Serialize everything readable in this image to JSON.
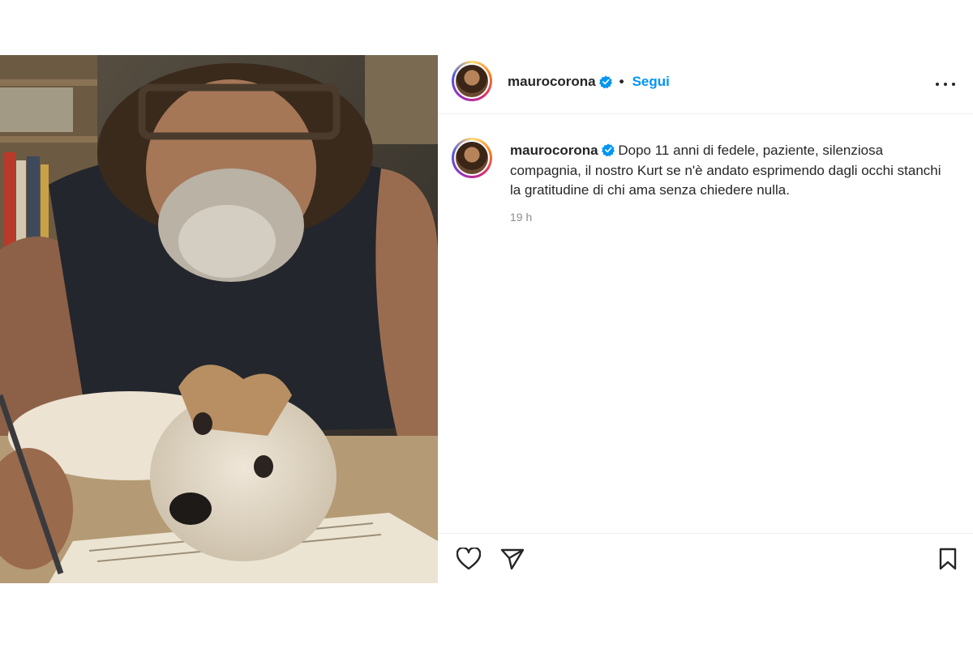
{
  "post": {
    "username": "maurocorona",
    "follow_label": "Segui",
    "separator": "•",
    "caption": "Dopo 11 anni di fedele, paziente, silenziosa compagnia, il nostro Kurt se n'è andato esprimendo dagli occhi stanchi la gratitudine di chi ama senza chiedere nulla.",
    "time_ago": "19 h"
  },
  "icons": {
    "verified": "verified-badge-icon",
    "more": "more-options-icon",
    "like": "heart-icon",
    "share": "paper-plane-icon",
    "save": "bookmark-icon"
  },
  "colors": {
    "accent": "#0095f6",
    "text": "#262626",
    "muted": "#8e8e8e",
    "divider": "#efefef"
  }
}
